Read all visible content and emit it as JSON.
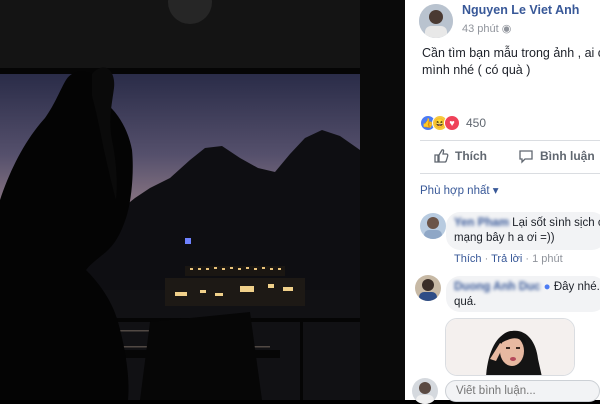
{
  "post": {
    "author": "Nguyen Le Viet Anh",
    "time": "43 phút",
    "text_line1": "Cần tìm bạn mẫu trong ảnh , ai có c",
    "text_line2": "mình nhé ( có quà )",
    "reaction_count": "450",
    "like_label": "Thích",
    "comment_label": "Bình luận",
    "filter_label": "Phù hợp nhất ▾"
  },
  "comments": [
    {
      "name": "Yen Pham",
      "text1": "Lại sốt sình sịch cộ",
      "text2": "mạng bây h a ơi =))",
      "like_label": "Thích",
      "reply_label": "Trả lời",
      "time": "1 phút"
    },
    {
      "name": "Duong Anh Duc",
      "text1": "Đây nhé. K",
      "text2": "quá."
    }
  ],
  "compose": {
    "placeholder": "Viết bình luận..."
  },
  "colors": {
    "link_blue": "#385898",
    "panel_bg": "#ffffff",
    "bubble_bg": "#f2f3f5"
  }
}
